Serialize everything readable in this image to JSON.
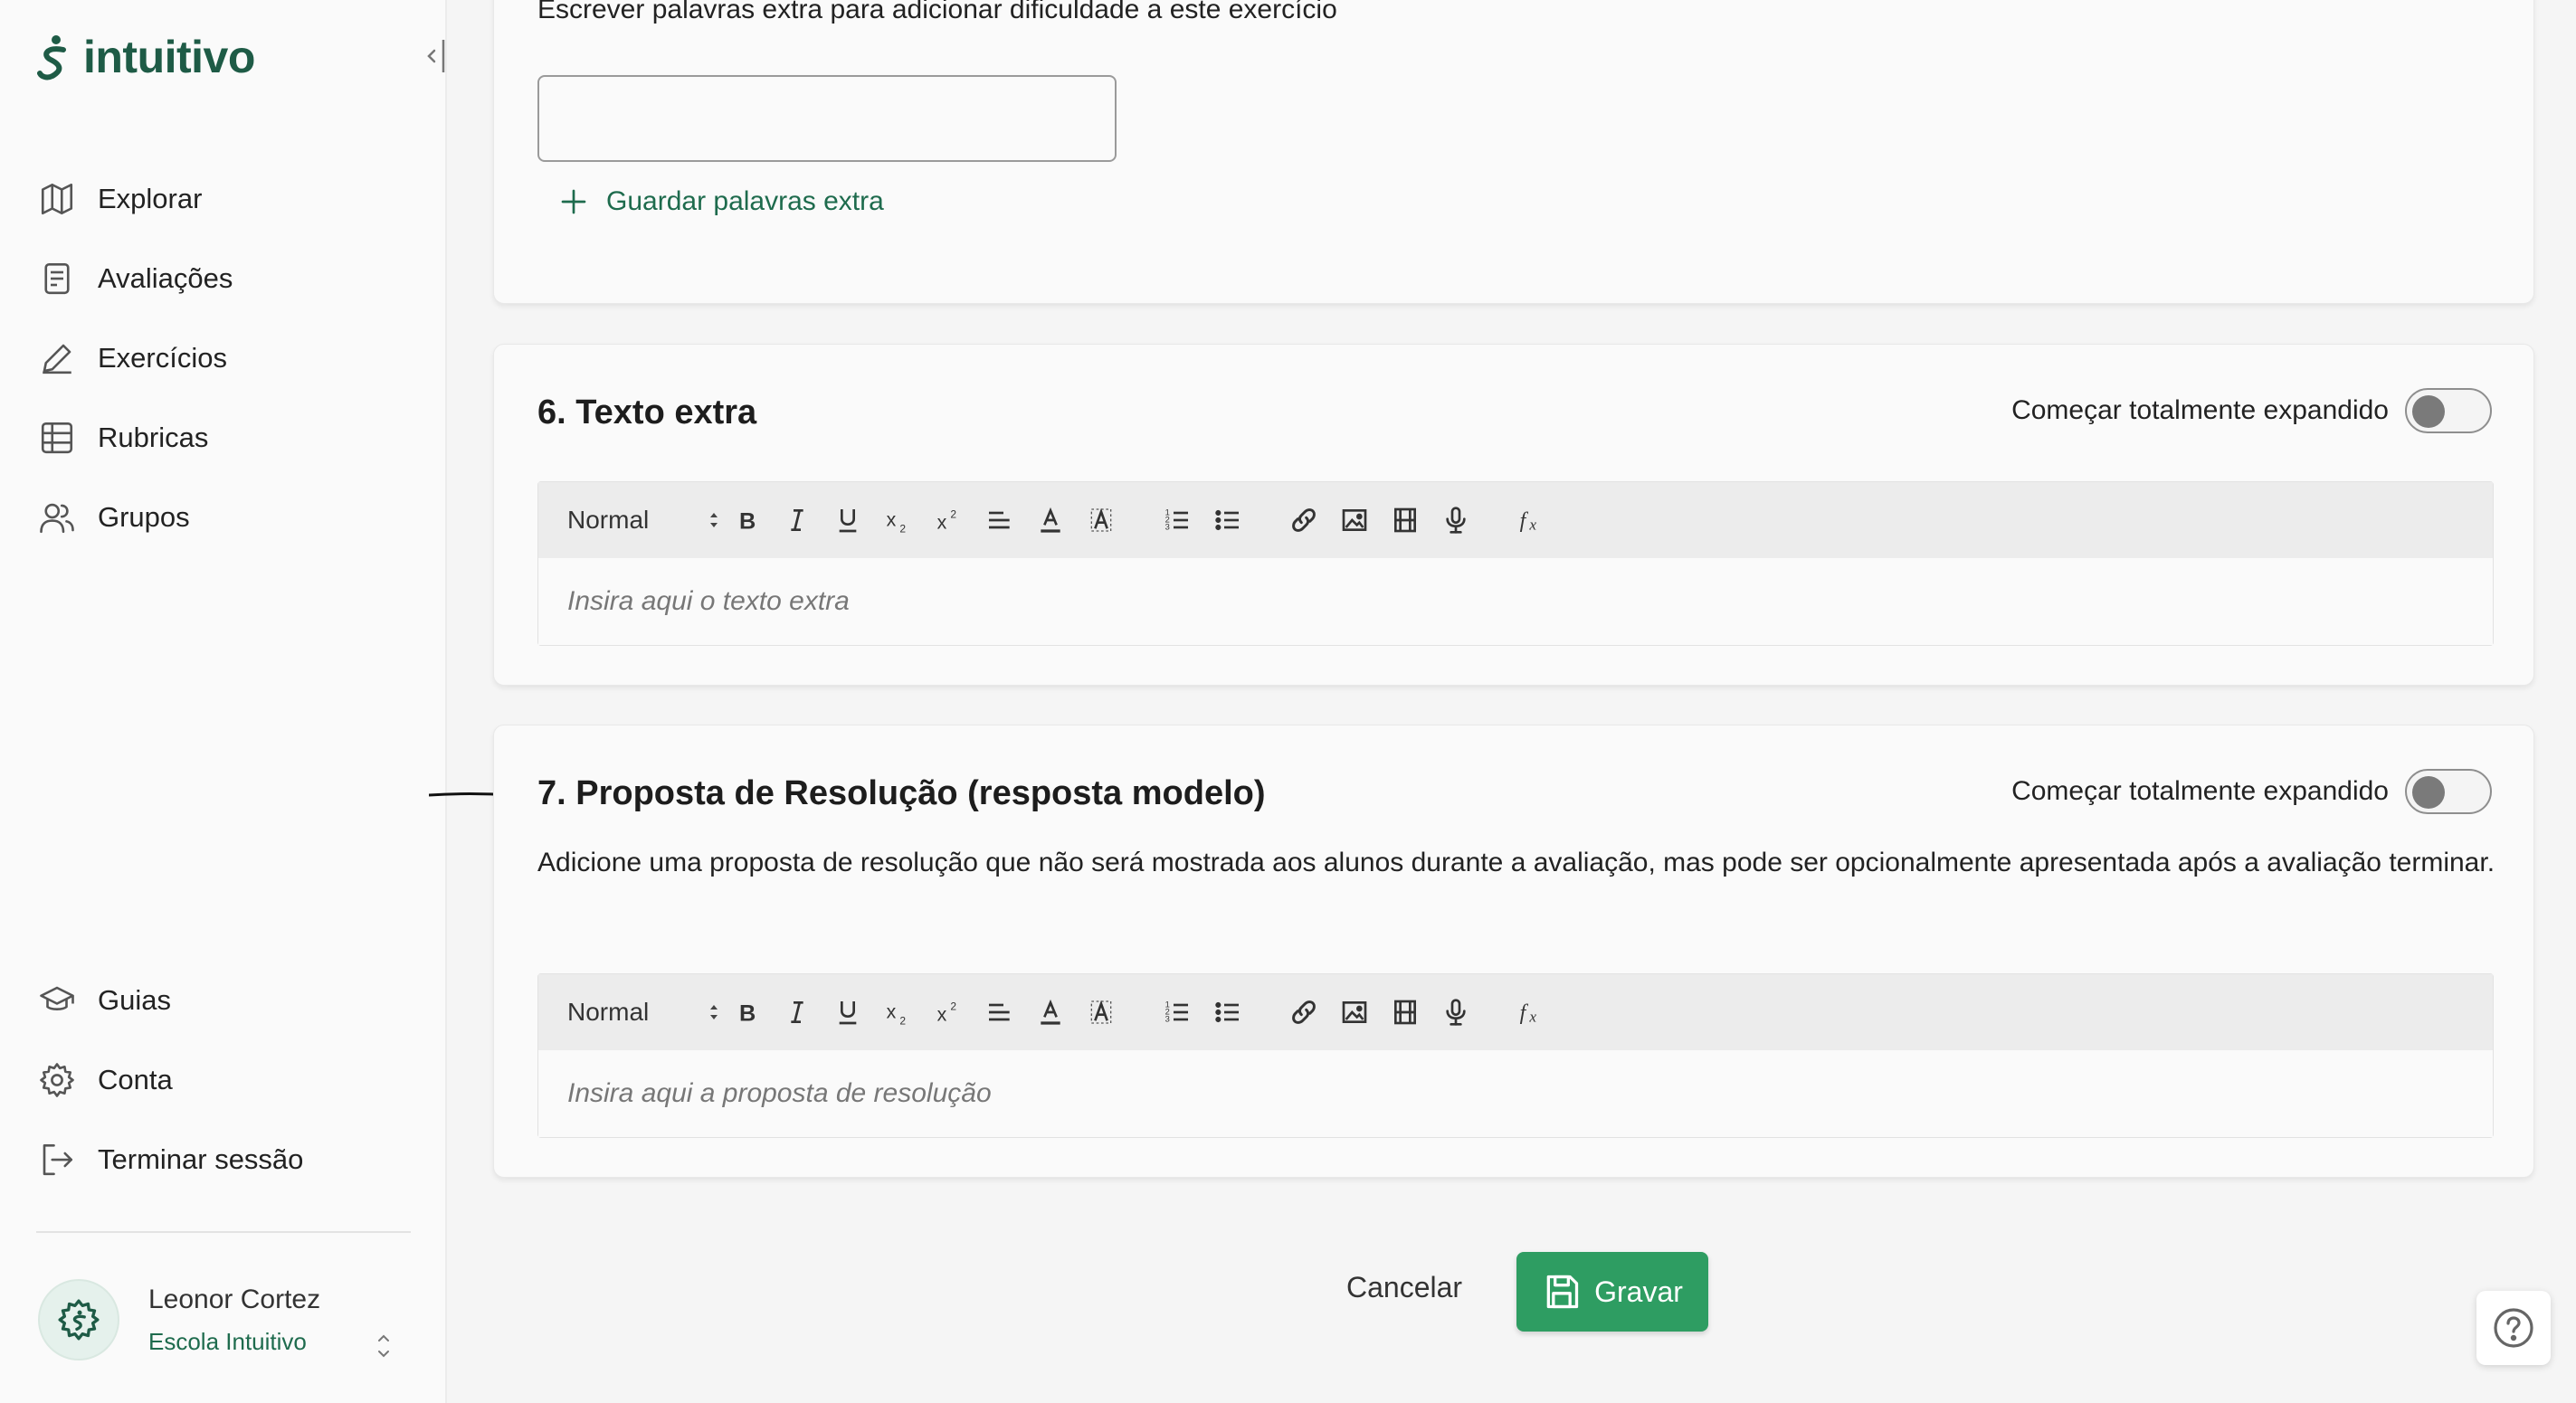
{
  "app": {
    "logo_text": "intuitivo"
  },
  "sidebar": {
    "items": [
      {
        "label": "Explorar",
        "icon": "map-icon"
      },
      {
        "label": "Avaliações",
        "icon": "document-icon"
      },
      {
        "label": "Exercícios",
        "icon": "pencil-icon"
      },
      {
        "label": "Rubricas",
        "icon": "grid-icon"
      },
      {
        "label": "Grupos",
        "icon": "users-icon"
      }
    ],
    "bottom_items": [
      {
        "label": "Guias",
        "icon": "graduation-cap-icon"
      },
      {
        "label": "Conta",
        "icon": "gear-icon"
      },
      {
        "label": "Terminar sessão",
        "icon": "logout-icon"
      }
    ],
    "user": {
      "name": "Leonor Cortez",
      "school": "Escola Intuitivo"
    }
  },
  "extra_words": {
    "helper": "Escrever palavras extra para adicionar dificuldade a este exercício",
    "input_value": "",
    "save_label": "Guardar palavras extra"
  },
  "section6": {
    "title": "6. Texto extra",
    "toggle_label": "Começar totalmente expandido",
    "toggle_on": false,
    "format": "Normal",
    "placeholder": "Insira aqui o texto extra"
  },
  "section7": {
    "title": "7. Proposta de Resolução (resposta modelo)",
    "toggle_label": "Começar totalmente expandido",
    "toggle_on": false,
    "description": "Adicione uma proposta de resolução que não será mostrada aos alunos durante a avaliação, mas pode ser opcionalmente apresentada após a avaliação terminar.",
    "format": "Normal",
    "placeholder": "Insira aqui a proposta de resolução"
  },
  "footer": {
    "cancel_label": "Cancelar",
    "save_label": "Gravar"
  },
  "colors": {
    "brand": "#1e5b46",
    "accent": "#2e9d62",
    "link": "#1e6b4d"
  }
}
